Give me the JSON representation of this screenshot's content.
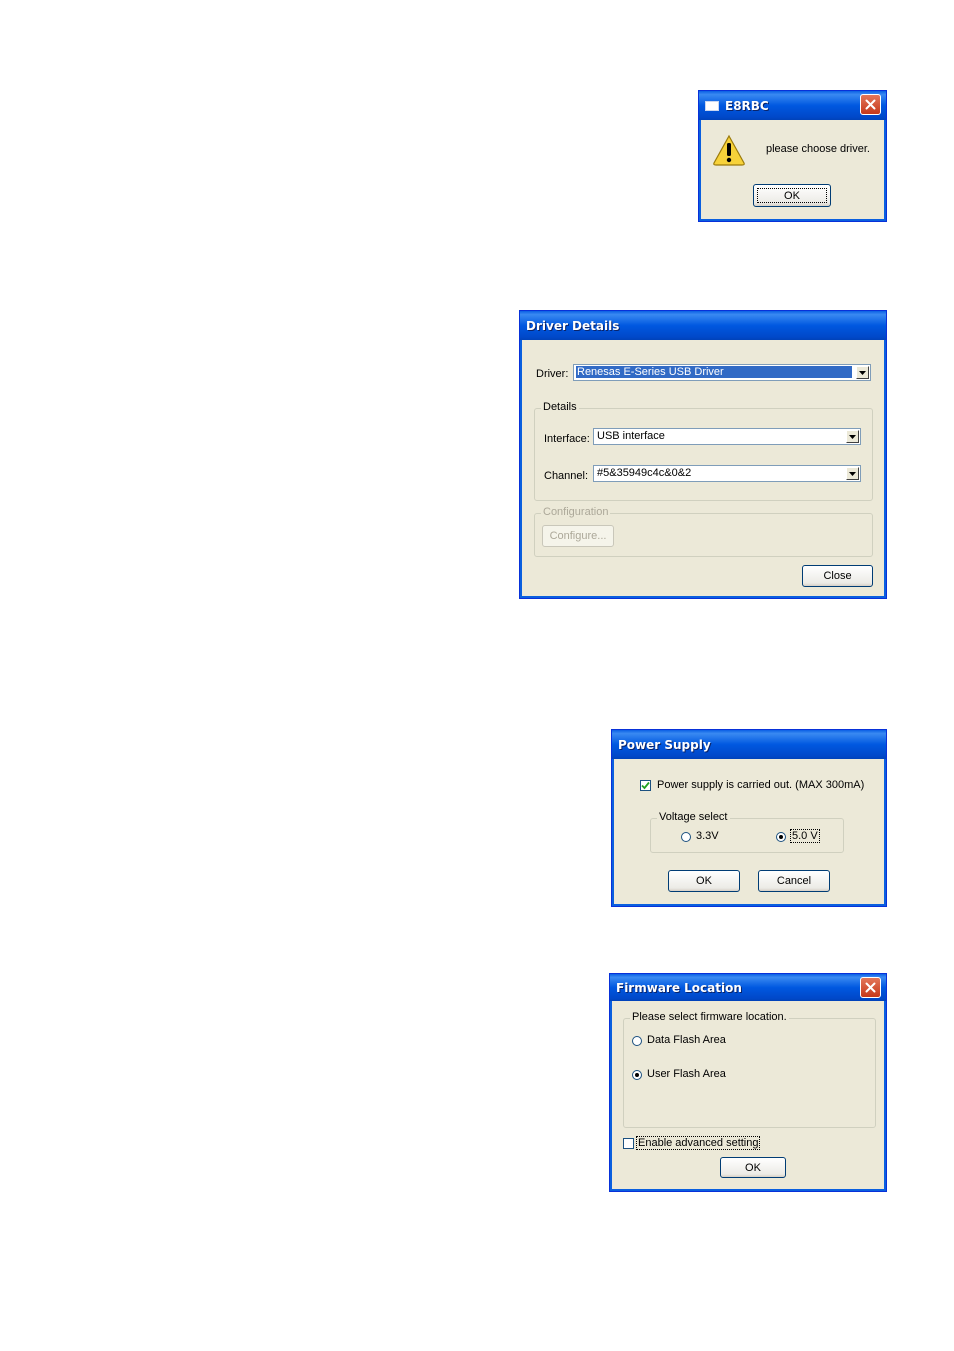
{
  "alert_dialog": {
    "title": "E8RBC",
    "message": "please choose driver.",
    "ok_label": "OK"
  },
  "driver_details": {
    "title": "Driver Details",
    "driver_label": "Driver:",
    "driver_value": "Renesas E-Series USB Driver",
    "details_group": "Details",
    "interface_label": "Interface:",
    "interface_value": "USB interface",
    "channel_label": "Channel:",
    "channel_value": "#5&35949c4c&0&2",
    "configuration_group": "Configuration",
    "configure_label": "Configure...",
    "close_label": "Close"
  },
  "power_supply": {
    "title": "Power Supply",
    "checkbox_label": "Power supply is carried out. (MAX 300mA)",
    "checkbox_checked": true,
    "voltage_group": "Voltage select",
    "option_33": "3.3V",
    "option_50": "5.0 V",
    "selected": "5.0 V",
    "ok_label": "OK",
    "cancel_label": "Cancel"
  },
  "firmware_location": {
    "title": "Firmware Location",
    "group_label": "Please select firmware location.",
    "option_data_flash": "Data Flash Area",
    "option_user_flash": "User Flash Area",
    "selected": "User Flash Area",
    "advanced_label": "Enable advanced setting",
    "advanced_checked": false,
    "ok_label": "OK"
  },
  "colors": {
    "titlebar": "#0054e3",
    "dialog_bg": "#ece9d8",
    "selection": "#316ac5",
    "close_red": "#d6522e"
  }
}
